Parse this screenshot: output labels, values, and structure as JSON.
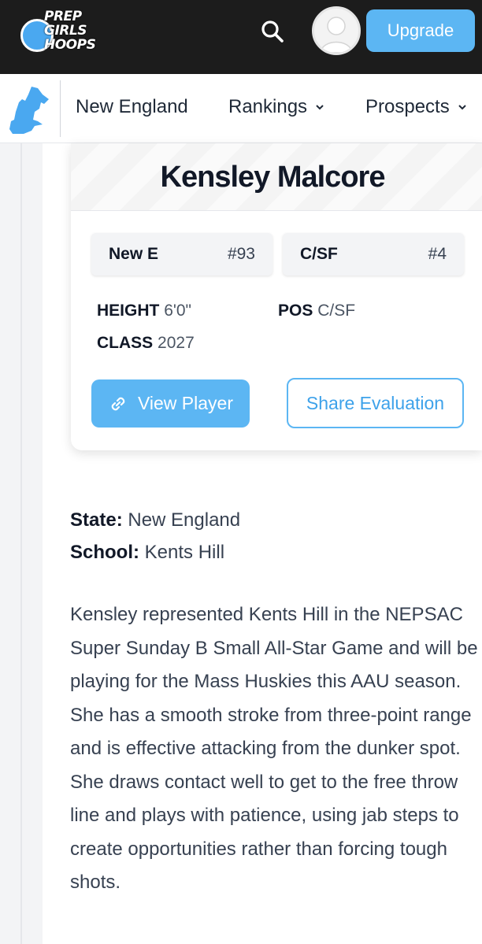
{
  "header": {
    "logo_lines": [
      "PREP",
      "GIRLS",
      "HOOPS"
    ],
    "upgrade_label": "Upgrade"
  },
  "nav": {
    "region": "New England",
    "items": [
      {
        "label": "New England",
        "has_menu": false
      },
      {
        "label": "Rankings",
        "has_menu": true
      },
      {
        "label": "Prospects",
        "has_menu": true
      }
    ]
  },
  "player": {
    "name": "Kensley Malcore",
    "rankings": [
      {
        "label": "New E",
        "rank": "#93"
      },
      {
        "label": "C/SF",
        "rank": "#4"
      }
    ],
    "height_label": "HEIGHT",
    "height_value": "6'0\"",
    "pos_label": "POS",
    "pos_value": "C/SF",
    "class_label": "CLASS",
    "class_value": "2027",
    "view_label": "View Player",
    "share_label": "Share Evaluation"
  },
  "details": {
    "state_label": "State:",
    "state_value": "New England",
    "school_label": "School:",
    "school_value": "Kents Hill"
  },
  "evaluation": "Kensley represented Kents Hill in the NEPSAC Super Sunday B Small All-Star Game and will be playing for the Mass Huskies this AAU season. She has a smooth stroke from three-point range and is effective attacking from the dunker spot. She draws contact well to get to the free throw line and plays with patience, using jab steps to create opportunities rather than forcing tough shots.",
  "colors": {
    "accent": "#5cb6f3",
    "topbar": "#1c1c1c"
  }
}
